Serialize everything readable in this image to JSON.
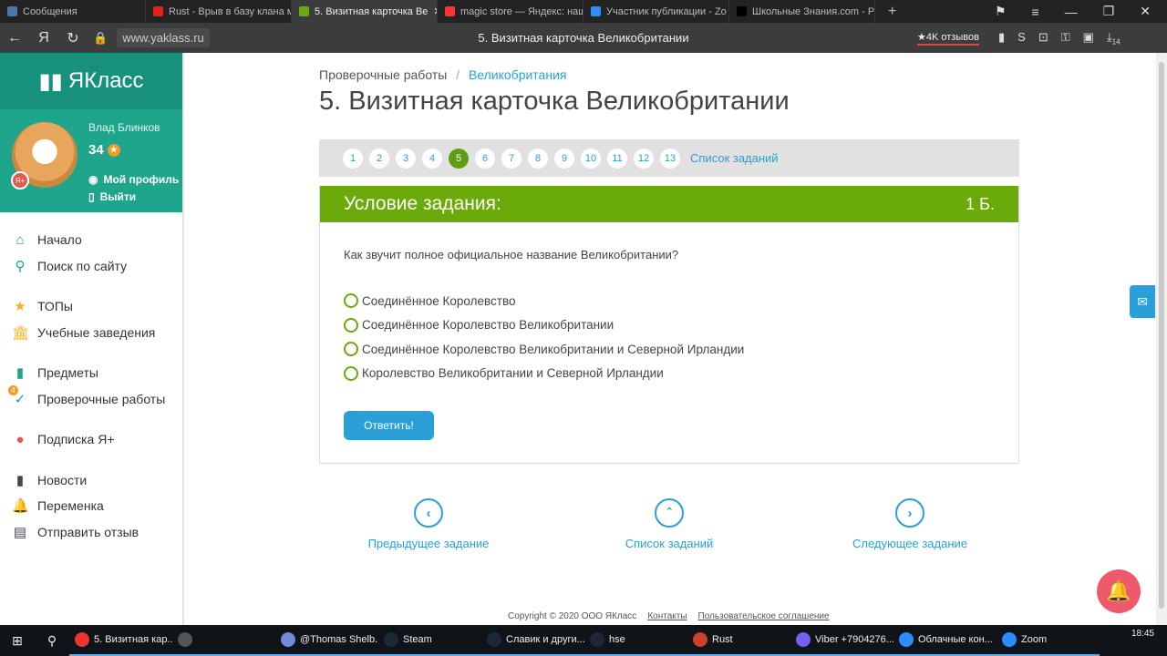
{
  "browser": {
    "tabs": [
      {
        "label": "Сообщения",
        "color": "#4a76a8"
      },
      {
        "label": "Rust - Врыв в базу клана м",
        "color": "#e62117"
      },
      {
        "label": "5. Визитная карточка Ве",
        "color": "#6aab0b",
        "active": true
      },
      {
        "label": "magic store — Яндекс: наш",
        "color": "#f33"
      },
      {
        "label": "Участник публикации - Zo",
        "color": "#2d8cff"
      },
      {
        "label": "Школьные Знания.com - Р",
        "color": "#000"
      }
    ],
    "new_tab": "+",
    "url": "www.yaklass.ru",
    "page_title": "5. Визитная карточка Великобритании",
    "reviews": "★4K отзывов",
    "download_count": "14"
  },
  "sidebar": {
    "logo": "ЯКласс",
    "user_name": "Влад Блинков",
    "score": "34",
    "profile_link": "Мой профиль",
    "logout_link": "Выйти",
    "badge": "Я+",
    "menu": [
      {
        "label": "Начало",
        "icon": "⌂",
        "color": "#1ea58b"
      },
      {
        "label": "Поиск по сайту",
        "icon": "⚲",
        "color": "#1ea58b"
      },
      {
        "label": "ТОПы",
        "icon": "★",
        "color": "#f3b325"
      },
      {
        "label": "Учебные заведения",
        "icon": "🏛",
        "color": "#f3b325"
      },
      {
        "label": "Предметы",
        "icon": "▮",
        "color": "#1ea58b"
      },
      {
        "label": "Проверочные работы",
        "icon": "✓",
        "color": "#1ea58b",
        "badge": "4"
      },
      {
        "label": "Подписка Я+",
        "icon": "●",
        "color": "#e45a4a"
      },
      {
        "label": "Новости",
        "icon": "▮",
        "color": "#445"
      },
      {
        "label": "Переменка",
        "icon": "🔔",
        "color": "#445"
      },
      {
        "label": "Отправить отзыв",
        "icon": "▤",
        "color": "#445"
      }
    ]
  },
  "main": {
    "breadcrumb": [
      "Проверочные работы",
      "Великобритания"
    ],
    "separator": "/",
    "title": "5. Визитная карточка Великобритании",
    "pages": [
      "1",
      "2",
      "3",
      "4",
      "5",
      "6",
      "7",
      "8",
      "9",
      "10",
      "11",
      "12",
      "13"
    ],
    "current_page": "5",
    "task_list_link": "Список заданий",
    "task_header": "Условие задания:",
    "points": "1 Б.",
    "question": "Как звучит полное официальное название Великобритании?",
    "options": [
      "Соединённое Королевство",
      "Соединённое Королевство Великобритании",
      "Соединённое Королевство Великобритании и Северной Ирландии",
      "Королевство Великобритании и Северной Ирландии"
    ],
    "answer_button": "Ответить!",
    "prev": "Предыдущее задание",
    "list": "Список заданий",
    "next": "Следующее задание"
  },
  "footer": {
    "copyright": "Copyright © 2020 ООО ЯКласс",
    "contacts": "Контакты",
    "agreement": "Пользовательское соглашение"
  },
  "taskbar": {
    "items": [
      {
        "label": "5. Визитная кар...",
        "color": "#e33"
      },
      {
        "label": "",
        "color": "#555"
      },
      {
        "label": "@Thomas Shelb...",
        "color": "#7289da"
      },
      {
        "label": "Steam",
        "color": "#1b2838"
      },
      {
        "label": "Славик и други...",
        "color": "#1b2838"
      },
      {
        "label": "hse",
        "color": "#1b2838"
      },
      {
        "label": "Rust",
        "color": "#cd412b"
      },
      {
        "label": "Viber +7904276...",
        "color": "#7360f2"
      },
      {
        "label": "Облачные кон...",
        "color": "#2d8cff"
      },
      {
        "label": "Zoom",
        "color": "#2d8cff"
      }
    ],
    "clock": "18:45"
  }
}
